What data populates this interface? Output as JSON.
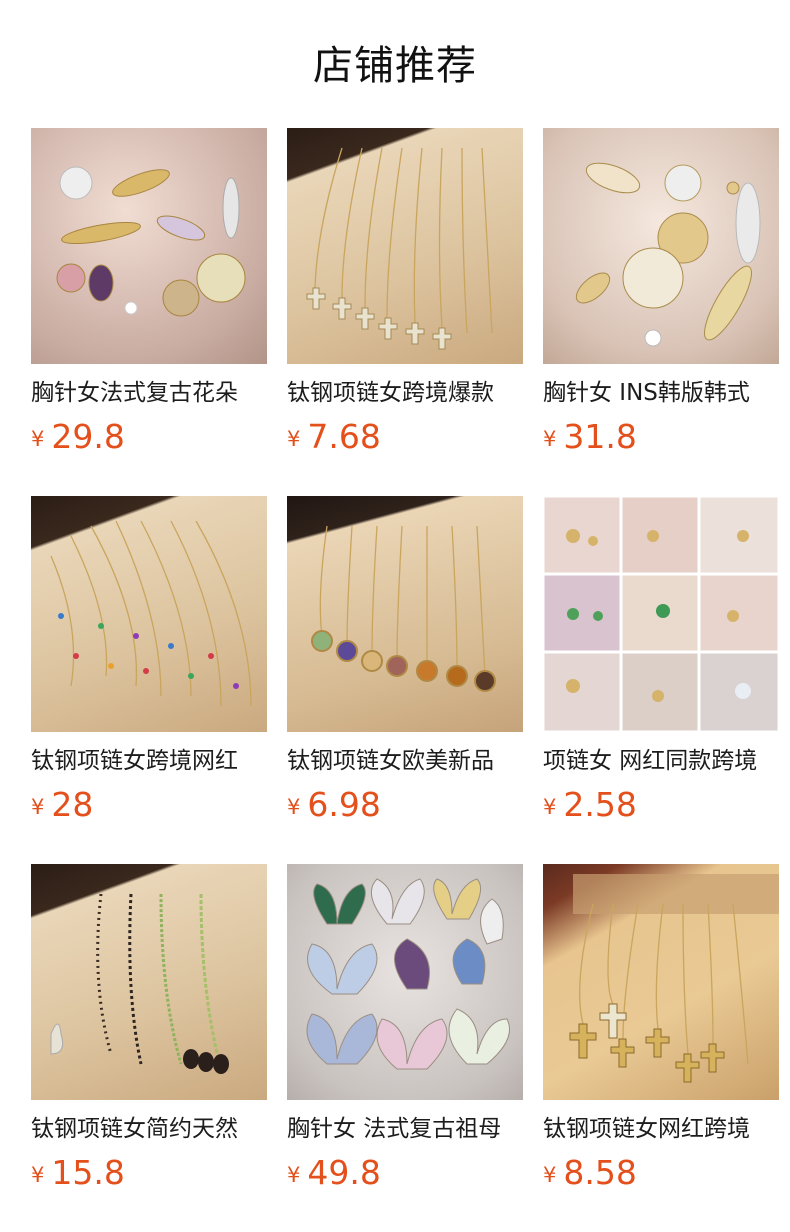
{
  "section_title": "店铺推荐",
  "currency": "¥",
  "products": [
    {
      "name": "胸针女法式复古花朵",
      "price": "29.8"
    },
    {
      "name": "钛钢项链女跨境爆款",
      "price": "7.68"
    },
    {
      "name": "胸针女 INS韩版韩式",
      "price": "31.8"
    },
    {
      "name": "钛钢项链女跨境网红",
      "price": "28"
    },
    {
      "name": "钛钢项链女欧美新品",
      "price": "6.98"
    },
    {
      "name": "项链女 网红同款跨境",
      "price": "2.58"
    },
    {
      "name": "钛钢项链女简约天然",
      "price": "15.8"
    },
    {
      "name": "胸针女 法式复古祖母",
      "price": "49.8"
    },
    {
      "name": "钛钢项链女网红跨境",
      "price": "8.58"
    }
  ],
  "colors": {
    "price": "#e4501c",
    "title": "#111111"
  }
}
